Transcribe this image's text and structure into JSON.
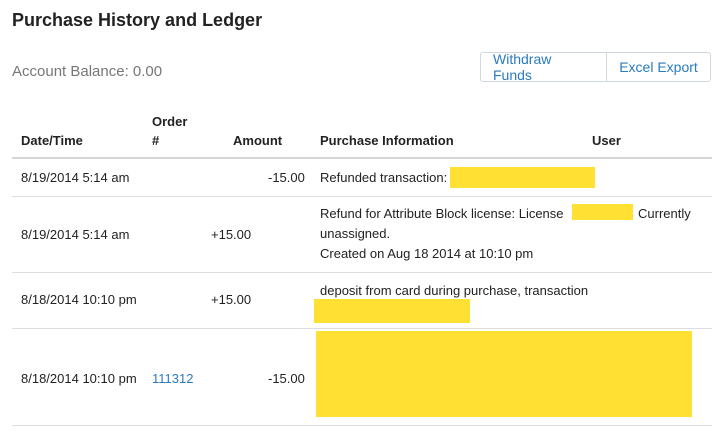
{
  "header": {
    "title": "Purchase History and Ledger",
    "balance": "Account Balance: 0.00",
    "withdraw_label": "Withdraw Funds",
    "export_label": "Excel Export"
  },
  "table": {
    "columns": {
      "date": "Date/Time",
      "order_line1": "Order",
      "order_line2": "#",
      "amount": "Amount",
      "info": "Purchase Information",
      "user": "User"
    },
    "rows": [
      {
        "date": "8/19/2014 5:14 am",
        "order": "",
        "amount": "-15.00",
        "info": "Refunded transaction:"
      },
      {
        "date": "8/19/2014 5:14 am",
        "order": "",
        "amount": "+15.00",
        "info_pre": "Refund for Attribute Block license: License",
        "info_post": "Currently",
        "info_line2": "unassigned.",
        "info_line3": "Created on Aug 18 2014 at 10:10 pm"
      },
      {
        "date": "8/18/2014 10:10 pm",
        "order": "",
        "amount": "+15.00",
        "info": "deposit from card during purchase, transaction"
      },
      {
        "date": "8/18/2014 10:10 pm",
        "order": "111312",
        "amount": "-15.00",
        "info": ""
      }
    ]
  },
  "colors": {
    "accent": "#2a7bbf",
    "redaction": "#ffe033"
  }
}
